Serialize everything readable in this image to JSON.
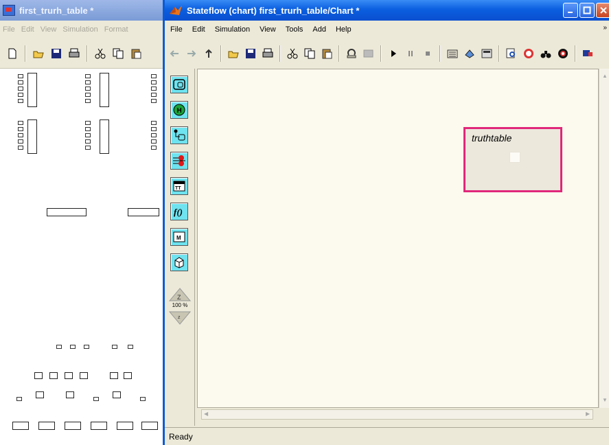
{
  "background_window": {
    "title": "first_trurh_table *",
    "menu": [
      "File",
      "Edit",
      "View",
      "Simulation",
      "Format"
    ]
  },
  "stateflow_window": {
    "title": "Stateflow (chart) first_trurh_table/Chart *",
    "menu": [
      "File",
      "Edit",
      "Simulation",
      "View",
      "Tools",
      "Add",
      "Help"
    ],
    "menu_overflow": "»",
    "palette_tools": [
      "state-tool",
      "history-junction-tool",
      "default-transition-tool",
      "connective-junction-tool",
      "truth-table-tool",
      "function-tool",
      "embedded-matlab-function-tool",
      "box-tool"
    ],
    "zoom_label": "100 %",
    "state": {
      "label": "truthtable"
    },
    "status": "Ready",
    "colors": {
      "titlebar": "#0b5fe0",
      "state_border": "#e0267a",
      "canvas": "#fcf9ee",
      "palette_button": "#6fe3ef"
    }
  }
}
